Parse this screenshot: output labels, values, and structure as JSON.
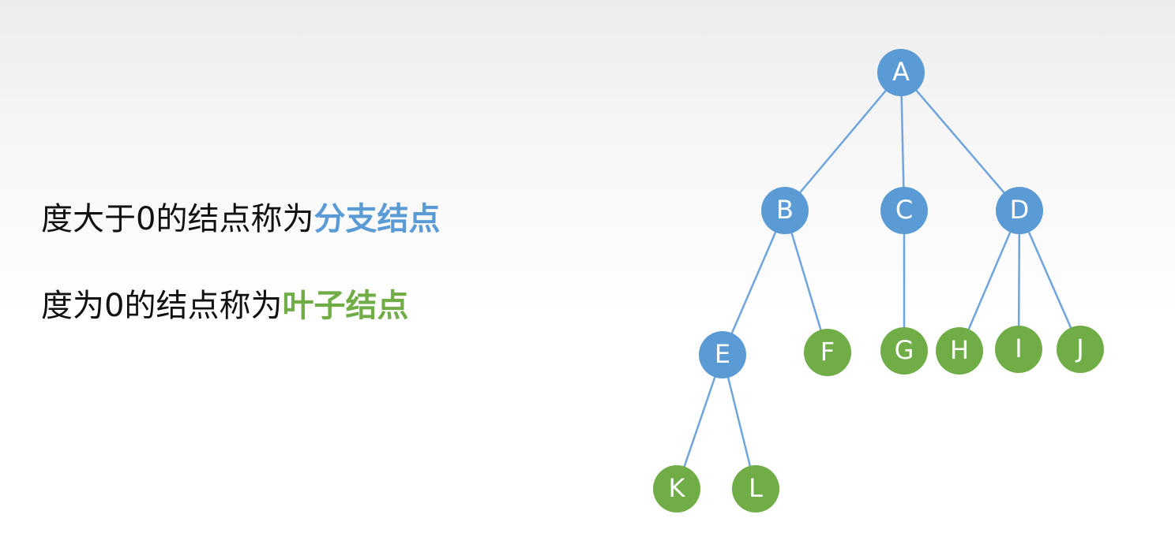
{
  "text": {
    "line1": {
      "prefix": "度大于0的结点称为",
      "highlight": "分支结点"
    },
    "line2": {
      "prefix": "度为0的结点称为",
      "highlight": "叶子结点"
    }
  },
  "colors": {
    "branch": "#5b9bd5",
    "leaf": "#70ad47",
    "edge": "#6fa5dc"
  },
  "tree": {
    "nodes": [
      {
        "id": "A",
        "type": "branch"
      },
      {
        "id": "B",
        "type": "branch"
      },
      {
        "id": "C",
        "type": "branch"
      },
      {
        "id": "D",
        "type": "branch"
      },
      {
        "id": "E",
        "type": "branch"
      },
      {
        "id": "F",
        "type": "leaf"
      },
      {
        "id": "G",
        "type": "leaf"
      },
      {
        "id": "H",
        "type": "leaf"
      },
      {
        "id": "I",
        "type": "leaf"
      },
      {
        "id": "J",
        "type": "leaf"
      },
      {
        "id": "K",
        "type": "leaf"
      },
      {
        "id": "L",
        "type": "leaf"
      }
    ],
    "edges": [
      [
        "A",
        "B"
      ],
      [
        "A",
        "C"
      ],
      [
        "A",
        "D"
      ],
      [
        "B",
        "E"
      ],
      [
        "B",
        "F"
      ],
      [
        "C",
        "G"
      ],
      [
        "D",
        "H"
      ],
      [
        "D",
        "I"
      ],
      [
        "D",
        "J"
      ],
      [
        "E",
        "K"
      ],
      [
        "E",
        "L"
      ]
    ]
  }
}
